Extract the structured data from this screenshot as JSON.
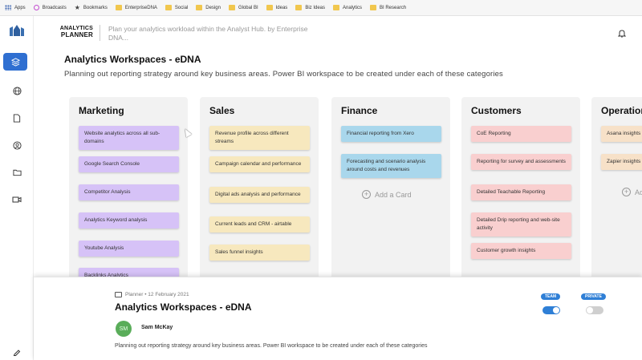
{
  "bookmarks": [
    {
      "label": "Apps",
      "icon": "apps-grid-icon"
    },
    {
      "label": "Broadcasts",
      "icon": "broadcast-icon"
    },
    {
      "label": "Bookmarks",
      "icon": "star-icon"
    },
    {
      "label": "EnterpriseDNA",
      "icon": "folder-icon"
    },
    {
      "label": "Social",
      "icon": "folder-icon"
    },
    {
      "label": "Design",
      "icon": "folder-icon"
    },
    {
      "label": "Global BI",
      "icon": "folder-icon"
    },
    {
      "label": "Ideas",
      "icon": "folder-icon"
    },
    {
      "label": "Biz Ideas",
      "icon": "folder-icon"
    },
    {
      "label": "Analytics",
      "icon": "folder-icon"
    },
    {
      "label": "BI Research",
      "icon": "folder-icon"
    }
  ],
  "sidebar": {
    "icons": [
      "layers-icon",
      "globe-icon",
      "document-icon",
      "user-circle-icon",
      "folder-icon",
      "video-icon",
      "pen-icon"
    ]
  },
  "header": {
    "brand_line1": "ANALYTICS",
    "brand_line2": "PLANNER",
    "tagline": "Plan your analytics workload within the Analyst Hub. by Enterprise DNA..."
  },
  "page": {
    "title": "Analytics Workspaces - eDNA",
    "subtitle": "Planning out reporting strategy around key business areas. Power BI workspace to be created under each of these categories"
  },
  "columns": [
    {
      "title": "Marketing",
      "cards": [
        "Website analytics across all sub-domains",
        "Google Search Console",
        "Competitor Analysis",
        "Analytics Keyword analysis",
        "Youtube Analysis",
        "Backlinks Analytics"
      ]
    },
    {
      "title": "Sales",
      "cards": [
        "Revenue profile across different streams",
        "Campaign calendar and performance",
        "Digital ads analysis and performance",
        "Current leads and CRM - airtable",
        "Sales funnel insights"
      ]
    },
    {
      "title": "Finance",
      "cards": [
        "Financial reporting from Xero",
        "Forecasting and scenario analysis around costs and revenues"
      ],
      "add_label": "Add a Card"
    },
    {
      "title": "Customers",
      "cards": [
        "CoE Reporting",
        "Reporting for survey and assessments",
        "Detailed Teachable Reporting",
        "Detailed Drip reporting and web-site activity",
        "Customer growth insights"
      ]
    },
    {
      "title": "Operations",
      "cards": [
        "Asana insights",
        "Zapier insights"
      ],
      "add_label": "Add a Card"
    }
  ],
  "detail": {
    "source": "Planner",
    "date": "12 February 2021",
    "title": "Analytics Workspaces - eDNA",
    "avatar_initials": "SM",
    "author": "Sam McKay",
    "description": "Planning out reporting strategy around key business areas. Power BI workspace to be created under each of these categories",
    "team_label": "TEAM",
    "private_label": "PRIVATE",
    "team_on": true,
    "private_on": false
  }
}
